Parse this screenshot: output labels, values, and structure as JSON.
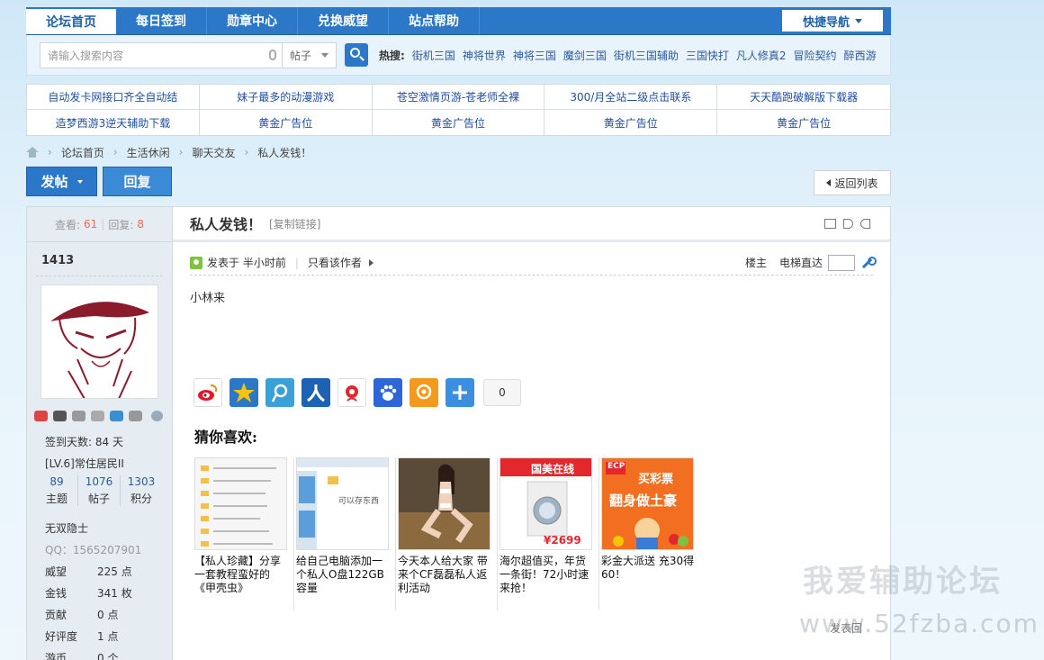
{
  "topnav": {
    "tabs": [
      "论坛首页",
      "每日签到",
      "勋章中心",
      "兑换威望",
      "站点帮助"
    ],
    "quick_nav": "快捷导航"
  },
  "search": {
    "placeholder": "请输入搜索内容",
    "type": "帖子",
    "hot_label": "热搜:",
    "hot_items": [
      "街机三国",
      "神将世界",
      "神将三国",
      "魔剑三国",
      "街机三国辅助",
      "三国快打",
      "凡人修真2",
      "冒险契约",
      "醉西游"
    ]
  },
  "ads": [
    "自动发卡网接口齐全自动结",
    "妹子最多的动漫游戏",
    "苍空激情页游-苍老师全裸",
    "300/月全站二级点击联系",
    "天天酷跑破解版下载器",
    "造梦西游3逆天辅助下载",
    "黄金广告位",
    "黄金广告位",
    "黄金广告位",
    "黄金广告位"
  ],
  "breadcrumb": [
    "论坛首页",
    "生活休闲",
    "聊天交友",
    "私人发钱！"
  ],
  "actions": {
    "post": "发帖",
    "reply": "回复",
    "back": "返回列表"
  },
  "side": {
    "views_label": "查看:",
    "views": "61",
    "replies_label": "回复:",
    "replies": "8",
    "username": "1413",
    "signin_days": "签到天数: 84 天",
    "level": "[LV.6]常住居民II",
    "stats": [
      {
        "value": "89",
        "label": "主题"
      },
      {
        "value": "1076",
        "label": "帖子"
      },
      {
        "value": "1303",
        "label": "积分"
      }
    ],
    "title": "无双隐士",
    "qq": "QQ：1565207901",
    "props": [
      {
        "key": "威望",
        "value": "225 点"
      },
      {
        "key": "金钱",
        "value": "341 枚"
      },
      {
        "key": "贡献",
        "value": "0 点"
      },
      {
        "key": "好评度",
        "value": "1 点"
      },
      {
        "key": "游币",
        "value": "0 个"
      }
    ]
  },
  "post": {
    "title": "私人发钱！",
    "copy_link": "[复制链接]",
    "posted_at": "发表于 半小时前",
    "only_author": "只看该作者",
    "floor": "楼主",
    "jump_label": "电梯直达",
    "content": "小林来",
    "share_count": "0",
    "guess_title": "猜你喜欢:",
    "cards": [
      {
        "caption": "【私人珍藏】分享一套教程蛮好的《甲壳虫》"
      },
      {
        "caption": "给自己电脑添加一个私人O盘122GB容量"
      },
      {
        "caption": "今天本人给大家 带来个CF磊磊私人返利活动"
      },
      {
        "caption": "海尔超值买，年货一条街！72小时速来抢！"
      },
      {
        "caption": "彩金大派送 充30得60！"
      }
    ]
  },
  "card_images": {
    "gome_text": "国美在线",
    "gome_price": "¥2699",
    "lottery_title": "买彩票",
    "lottery_slogan": "翻身做土豪",
    "lottery_brand": "ECP",
    "window_text": "可以存东西"
  },
  "watermark": {
    "line1": "我爱辅助论坛",
    "line2": "www.52fzba.com"
  },
  "reply_link": "发表回"
}
